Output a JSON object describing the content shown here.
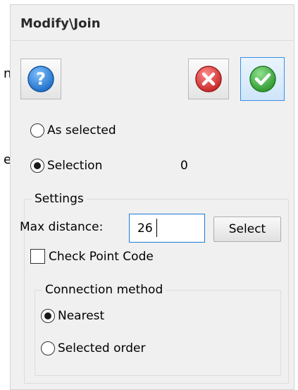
{
  "background_text": {
    "top": "n",
    "bottom": "e"
  },
  "dialog": {
    "title": "Modify\\Join",
    "toolbar": {
      "help_icon": "help-question-icon",
      "cancel_icon": "cancel-x-icon",
      "ok_icon": "ok-check-icon"
    },
    "mode": {
      "selected": "selection",
      "options": [
        {
          "id": "as_selected",
          "label": "As selected",
          "checked": false
        },
        {
          "id": "selection",
          "label": "Selection",
          "checked": true
        }
      ],
      "selection_count": "0"
    },
    "settings": {
      "legend": "Settings",
      "max_distance_label": "Max distance:",
      "max_distance_value": "26",
      "select_button_label": "Select",
      "check_point_code_label": "Check Point Code",
      "check_point_code_checked": false,
      "connection": {
        "legend": "Connection method",
        "options": [
          {
            "id": "nearest",
            "label": "Nearest",
            "checked": true
          },
          {
            "id": "selected_order",
            "label": "Selected order",
            "checked": false
          }
        ]
      }
    }
  },
  "colors": {
    "panel_background": "#f0f0f0",
    "default_button_border": "#3d8ee6",
    "help_blue": "#1f6fc7",
    "cancel_red": "#d32f2f",
    "ok_green": "#3aa53a"
  }
}
